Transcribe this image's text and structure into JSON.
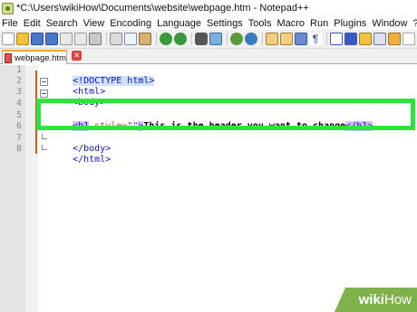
{
  "window": {
    "title": "*C:\\Users\\wikiHow\\Documents\\website\\webpage.htm - Notepad++"
  },
  "menu": {
    "items": [
      "File",
      "Edit",
      "Search",
      "View",
      "Encoding",
      "Language",
      "Settings",
      "Tools",
      "Macro",
      "Run",
      "Plugins",
      "Window",
      "?"
    ]
  },
  "toolbar": {
    "icons": [
      "new-file-icon",
      "open-file-icon",
      "save-icon",
      "save-all-icon",
      "close-icon",
      "close-all-icon",
      "print-icon",
      "cut-icon",
      "copy-icon",
      "paste-icon",
      "undo-icon",
      "redo-icon",
      "find-icon",
      "replace-icon",
      "zoom-in-icon",
      "zoom-out-icon",
      "sync-v-icon",
      "sync-h-icon",
      "word-wrap-icon",
      "all-chars-icon",
      "indent-guide-icon",
      "udl-icon",
      "doc-map-icon",
      "function-list-icon",
      "folder-workspace-icon",
      "monitoring-icon",
      "record-macro-icon",
      "stop-record-icon",
      "play-macro-icon"
    ]
  },
  "tab": {
    "label": "webpage.htm",
    "close_symbol": "✕"
  },
  "editor": {
    "line_numbers": [
      "1",
      "2",
      "3",
      "4",
      "5",
      "6",
      "7",
      "8"
    ],
    "lines": {
      "l1": "<!DOCTYPE html>",
      "l2": "<html>",
      "l3": "<body>",
      "l5_open": "<h1",
      "l5_attr": " style=",
      "l5_str": "\"\"",
      "l5_gt": ">",
      "l5_text": "This is the header you want to change",
      "l5_close": "</h1>",
      "l7": "</body>",
      "l8": "</html>"
    }
  },
  "watermark": {
    "wiki": "wiki",
    "how": "How"
  },
  "colors": {
    "highlight_box": "#2ee33a",
    "tag": "#1010c0",
    "attribute": "#c0571a",
    "selection": "#d0c0ff",
    "watermark_bg": "#7fb24a"
  }
}
